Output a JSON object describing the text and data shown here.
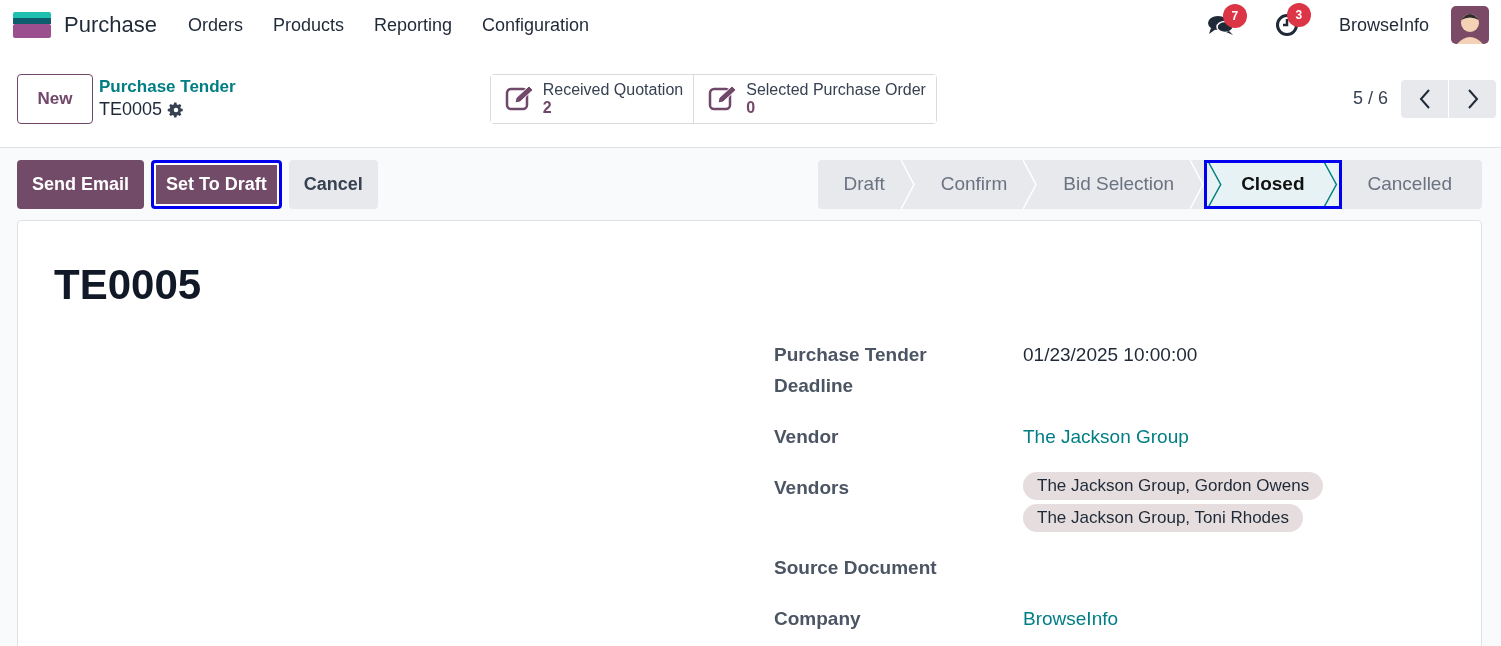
{
  "navbar": {
    "app_name": "Purchase",
    "menu": [
      "Orders",
      "Products",
      "Reporting",
      "Configuration"
    ],
    "messages_count": "7",
    "activities_count": "3",
    "company": "BrowseInfo"
  },
  "control_panel": {
    "new_button": "New",
    "breadcrumb": "Purchase Tender",
    "record": "TE0005",
    "smart_buttons": [
      {
        "label": "Received Quotation",
        "value": "2"
      },
      {
        "label": "Selected Purchase Order",
        "value": "0"
      }
    ],
    "pager": "5 / 6"
  },
  "actions": [
    {
      "label": "Send Email",
      "kind": "primary",
      "highlighted": false
    },
    {
      "label": "Set To Draft",
      "kind": "primary",
      "highlighted": true
    },
    {
      "label": "Cancel",
      "kind": "secondary",
      "highlighted": false
    }
  ],
  "stages": [
    {
      "label": "Draft",
      "selected": false,
      "highlighted": false
    },
    {
      "label": "Confirm",
      "selected": false,
      "highlighted": false
    },
    {
      "label": "Bid Selection",
      "selected": false,
      "highlighted": false
    },
    {
      "label": "Closed",
      "selected": true,
      "highlighted": true
    },
    {
      "label": "Cancelled",
      "selected": false,
      "highlighted": false
    }
  ],
  "form": {
    "title": "TE0005",
    "fields": [
      {
        "label": "Purchase Tender Deadline",
        "kind": "text",
        "value": "01/23/2025 10:00:00"
      },
      {
        "label": "Vendor",
        "kind": "link",
        "value": "The Jackson Group"
      },
      {
        "label": "Vendors",
        "kind": "tags",
        "tags": [
          "The Jackson Group, Gordon Owens",
          "The Jackson Group, Toni Rhodes"
        ]
      },
      {
        "label": "Source Document",
        "kind": "empty"
      },
      {
        "label": "Company",
        "kind": "link",
        "value": "BrowseInfo"
      }
    ]
  }
}
